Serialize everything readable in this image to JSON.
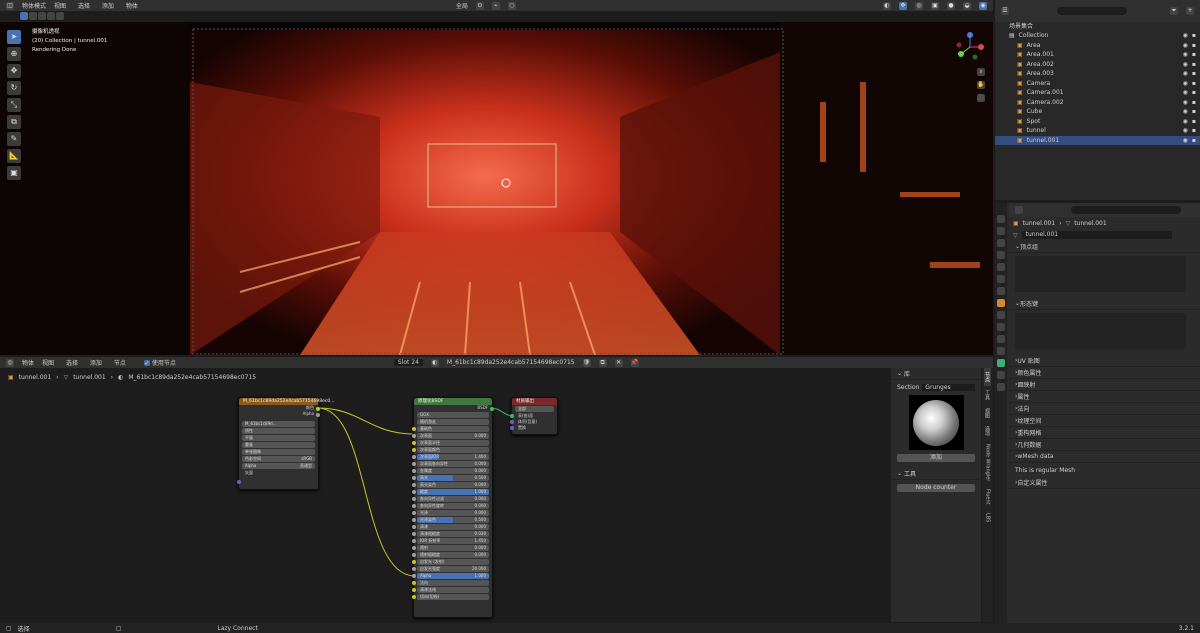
{
  "topbar": {
    "mode": "物体模式",
    "menus": [
      "视图",
      "选择",
      "添加",
      "物体"
    ],
    "transform": "全局",
    "pause_icon": "pause-icon"
  },
  "viewport": {
    "camera_title": "摄像机透视",
    "collection_line": "(20) Collection | tunnel.001",
    "status": "Rendering Done",
    "options": "选项"
  },
  "outliner": {
    "title": "场景集合",
    "rows": [
      {
        "name": "Collection",
        "indent": 0
      },
      {
        "name": "Area",
        "indent": 1
      },
      {
        "name": "Area.001",
        "indent": 1
      },
      {
        "name": "Area.002",
        "indent": 1
      },
      {
        "name": "Area.003",
        "indent": 1
      },
      {
        "name": "Camera",
        "indent": 1
      },
      {
        "name": "Camera.001",
        "indent": 1
      },
      {
        "name": "Camera.002",
        "indent": 1
      },
      {
        "name": "Cube",
        "indent": 1
      },
      {
        "name": "Spot",
        "indent": 1
      },
      {
        "name": "tunnel",
        "indent": 1
      },
      {
        "name": "tunnel.001",
        "indent": 1,
        "selected": true
      }
    ]
  },
  "properties": {
    "breadcrumb_obj": "tunnel.001",
    "breadcrumb_mesh": "tunnel.001",
    "mesh_name": "tunnel.001",
    "sections": [
      "顶点组",
      "形态键",
      "UV 贴图",
      "颜色属性",
      "面映射",
      "属性",
      "法向",
      "纹理空间",
      "重构网格",
      "几何数据",
      "wMesh data",
      "自定义属性"
    ],
    "mesh_note": "This is regular Mesh"
  },
  "node_editor": {
    "header": {
      "editor": "物体",
      "menus": [
        "视图",
        "选择",
        "添加",
        "节点"
      ],
      "use_nodes": "使用节点",
      "slot": "Slot 24",
      "material": "M_61bc1c89da252e4cab57154698ec0715"
    },
    "breadcrumb": [
      "tunnel.001",
      "tunnel.001",
      "M_61bc1c89da252e4cab57154698ec0715"
    ],
    "image_node": {
      "title": "M_61bc1c89da252e4cab57154698ec0...",
      "out1": "颜色",
      "out2": "Alpha",
      "image_name": "M_61bc1c89d...",
      "rows": [
        "线性",
        "平展",
        "重复",
        "单张图像",
        "色彩空间",
        "Alpha"
      ],
      "values": [
        "",
        "",
        "",
        "",
        "sRGB",
        "直通型"
      ],
      "vector": "矢量"
    },
    "bsdf_node": {
      "title": "原理化BSDF",
      "out": "BSDF",
      "dropdown1": "GGX",
      "dropdown2": "随机游走",
      "rows": [
        {
          "label": "基础色",
          "value": "",
          "fill": 0
        },
        {
          "label": "次表面",
          "value": "0.000",
          "fill": 0
        },
        {
          "label": "次表面半径",
          "value": "",
          "fill": 0
        },
        {
          "label": "次表面颜色",
          "value": "",
          "fill": 0
        },
        {
          "label": "次表面IOR",
          "value": "1.400",
          "fill": 0.3
        },
        {
          "label": "次表面各向异性",
          "value": "0.000",
          "fill": 0
        },
        {
          "label": "金属度",
          "value": "0.000",
          "fill": 0
        },
        {
          "label": "高光",
          "value": "0.500",
          "fill": 0.5
        },
        {
          "label": "高光染色",
          "value": "0.000",
          "fill": 0
        },
        {
          "label": "糙度",
          "value": "1.000",
          "fill": 1
        },
        {
          "label": "各向异性过滤",
          "value": "0.000",
          "fill": 0
        },
        {
          "label": "各向异性旋转",
          "value": "0.000",
          "fill": 0
        },
        {
          "label": "光泽",
          "value": "0.000",
          "fill": 0
        },
        {
          "label": "光泽染色",
          "value": "0.500",
          "fill": 0.5
        },
        {
          "label": "清漆",
          "value": "0.000",
          "fill": 0
        },
        {
          "label": "清漆粗糙度",
          "value": "0.030",
          "fill": 0
        },
        {
          "label": "IOR 折射率",
          "value": "1.450",
          "fill": 0
        },
        {
          "label": "透射",
          "value": "0.000",
          "fill": 0
        },
        {
          "label": "透射粗糙度",
          "value": "0.000",
          "fill": 0
        },
        {
          "label": "自发光 (发射)",
          "value": "",
          "fill": 0
        },
        {
          "label": "自发光强度",
          "value": "20.000",
          "fill": 0
        },
        {
          "label": "Alpha",
          "value": "1.000",
          "fill": 1
        },
        {
          "label": "法向",
          "value": "",
          "fill": 0
        },
        {
          "label": "清漆法线",
          "value": "",
          "fill": 0
        },
        {
          "label": "切向(切线)",
          "value": "",
          "fill": 0
        }
      ]
    },
    "output_node": {
      "title": "材质输出",
      "target": "全部",
      "rows": [
        "表(曲)面",
        "体积(音量)",
        "置换"
      ]
    }
  },
  "sidebar": {
    "panel_title": "库",
    "section_label": "Section",
    "section_value": "Grunges",
    "apply_button": "添加",
    "tools_title": "工具",
    "node_counter": "Node counter",
    "tabs": [
      "节点",
      "工具",
      "视图",
      "选项",
      "Node Wrangler",
      "Fluent",
      "LBS"
    ]
  },
  "statusbar": {
    "left": "选择",
    "mid": "Lazy Connect",
    "version": "3.2.1"
  }
}
